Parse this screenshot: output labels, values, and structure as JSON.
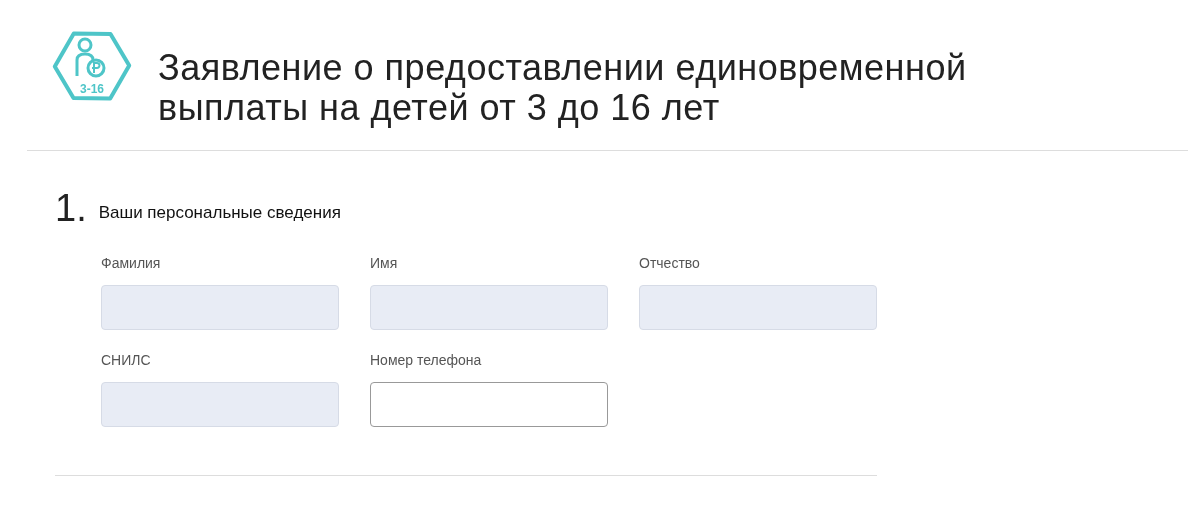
{
  "header": {
    "logo_text": "3-16",
    "title": "Заявление о предоставлении единовременной выплаты на детей от 3 до 16 лет"
  },
  "section": {
    "number": "1.",
    "title": "Ваши персональные сведения",
    "rows": [
      [
        {
          "label": "Фамилия",
          "disabled": true
        },
        {
          "label": "Имя",
          "disabled": true
        },
        {
          "label": "Отчество",
          "disabled": true
        }
      ],
      [
        {
          "label": "СНИЛС",
          "disabled": true
        },
        {
          "label": "Номер телефона",
          "disabled": false
        }
      ]
    ]
  }
}
